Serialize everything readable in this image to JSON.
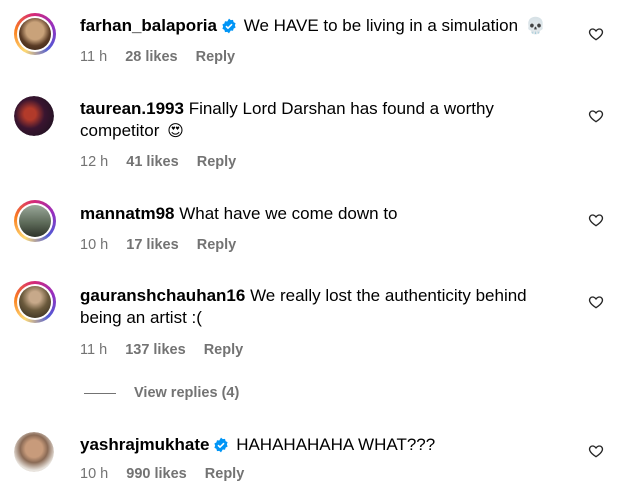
{
  "comments": [
    {
      "username": "farhan_balaporia",
      "verified": true,
      "text": "We HAVE to be living in a simulation",
      "emoji": "💀",
      "time": "11 h",
      "likes": "28 likes",
      "reply": "Reply"
    },
    {
      "username": "taurean.1993",
      "verified": false,
      "text": "Finally Lord Darshan has found a worthy competitor",
      "emoji": "😍",
      "time": "12 h",
      "likes": "41 likes",
      "reply": "Reply"
    },
    {
      "username": "mannatm98",
      "verified": false,
      "text": "What have we come down to",
      "emoji": "",
      "time": "10 h",
      "likes": "17 likes",
      "reply": "Reply"
    },
    {
      "username": "gauranshchauhan16",
      "verified": false,
      "text": "We really lost the authenticity behind being an artist :(",
      "emoji": "",
      "time": "11 h",
      "likes": "137 likes",
      "reply": "Reply"
    },
    {
      "username": "yashrajmukhate",
      "verified": true,
      "text": "HAHAHAHAHA WHAT???",
      "emoji": "",
      "time": "10 h",
      "likes": "990 likes",
      "reply": "Reply"
    }
  ],
  "view_replies": "View replies (4)",
  "colors": {
    "meta": "#737373",
    "verified": "#0095f6"
  },
  "icons": [
    "verified-badge-icon",
    "heart-icon"
  ]
}
